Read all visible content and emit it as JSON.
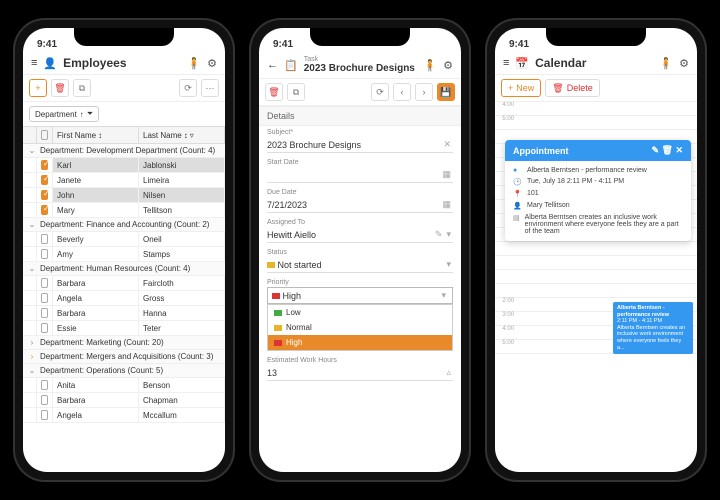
{
  "time": "9:41",
  "phone1": {
    "title": "Employees",
    "filter_chip": "Department",
    "col_first": "First Name",
    "col_last": "Last Name",
    "groups": [
      {
        "label": "Department: Development Department (Count: 4)",
        "open": true,
        "rows": [
          {
            "ck": true,
            "hi": true,
            "first": "Karl",
            "last": "Jablonski"
          },
          {
            "ck": true,
            "first": "Janete",
            "last": "Limeira"
          },
          {
            "ck": true,
            "hi": true,
            "first": "John",
            "last": "Nilsen"
          },
          {
            "ck": true,
            "first": "Mary",
            "last": "Tellitson"
          }
        ]
      },
      {
        "label": "Department: Finance and Accounting (Count: 2)",
        "open": true,
        "rows": [
          {
            "ck": false,
            "first": "Beverly",
            "last": "Oneil"
          },
          {
            "ck": false,
            "first": "Amy",
            "last": "Stamps"
          }
        ]
      },
      {
        "label": "Department: Human Resources (Count: 4)",
        "open": true,
        "rows": [
          {
            "ck": false,
            "first": "Barbara",
            "last": "Faircloth"
          },
          {
            "ck": false,
            "first": "Angela",
            "last": "Gross"
          },
          {
            "ck": false,
            "first": "Barbara",
            "last": "Hanna"
          },
          {
            "ck": false,
            "first": "Essie",
            "last": "Teter"
          }
        ]
      },
      {
        "label": "Department: Marketing (Count: 20)",
        "open": false,
        "rows": []
      },
      {
        "label": "Department: Mergers and Acquisitions (Count: 3)",
        "open": false,
        "hl": true,
        "rows": []
      },
      {
        "label": "Department: Operations (Count: 5)",
        "open": true,
        "rows": [
          {
            "ck": false,
            "first": "Anita",
            "last": "Benson"
          },
          {
            "ck": false,
            "first": "Barbara",
            "last": "Chapman"
          },
          {
            "ck": false,
            "first": "Angela",
            "last": "Mccallum"
          }
        ]
      }
    ]
  },
  "phone2": {
    "crumb": "Task",
    "title": "2023 Brochure Designs",
    "section": "Details",
    "subject_label": "Subject*",
    "subject": "2023 Brochure Designs",
    "start_label": "Start Date",
    "start": "",
    "due_label": "Due Date",
    "due": "7/21/2023",
    "assigned_label": "Assigned To",
    "assigned": "Hewitt Aiello",
    "status_label": "Status",
    "status": "Not started",
    "priority_label": "Priority",
    "priority": "High",
    "opts": [
      {
        "label": "Low",
        "cls": "low"
      },
      {
        "label": "Normal",
        "cls": "norm"
      },
      {
        "label": "High",
        "cls": "high",
        "sel": true
      }
    ],
    "est_label": "Estimated Work Hours",
    "est": "13"
  },
  "phone3": {
    "title": "Calendar",
    "new": "New",
    "delete": "Delete",
    "slots": [
      "4:00",
      "5:00",
      "",
      "",
      "",
      "",
      "",
      "",
      "",
      "",
      "",
      "",
      "",
      "",
      "2:00",
      "3:00",
      "4:00",
      "5:00"
    ],
    "popup": {
      "head": "Appointment",
      "subject": "Alberta Berntsen - performance review",
      "time": "Tue, July 18 2:11 PM - 4:11 PM",
      "room": "101",
      "who": "Mary Tellitson",
      "desc": "Alberta Berntsen creates an inclusive work environment where everyone feels they are a part of the team"
    },
    "event": {
      "title": "Alberta Berntsen - performance review",
      "time": "2:11 PM - 4:11 PM",
      "desc": "Alberta Berntsen creates an inclusive work environment where everyone feels they a..."
    }
  }
}
